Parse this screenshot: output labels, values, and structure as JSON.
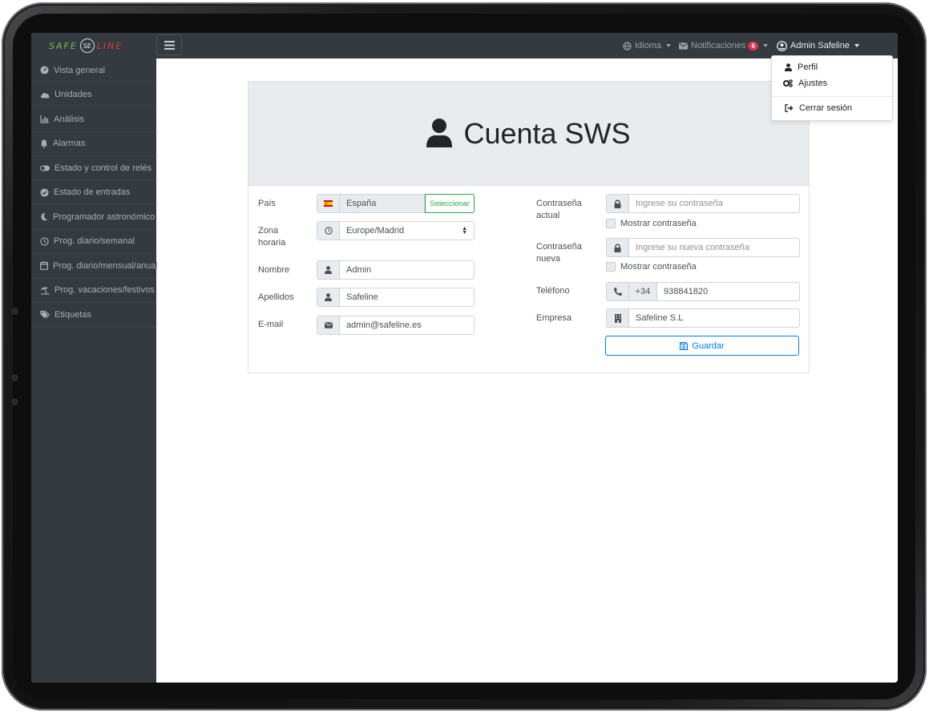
{
  "topbar": {
    "logo_left": "SAFE",
    "logo_mark": "SE",
    "logo_right": "LINE",
    "menu_icon": "hamburger-icon",
    "language": "Idioma",
    "notifications": "Notificaciones",
    "notifications_count": "6",
    "user": "Admin Safeline"
  },
  "sidebar": {
    "items": [
      {
        "label": "Vista general",
        "icon": "dashboard-icon"
      },
      {
        "label": "Unidades",
        "icon": "cloud-icon"
      },
      {
        "label": "Análisis",
        "icon": "chart-icon"
      },
      {
        "label": "Alarmas",
        "icon": "bell-icon"
      },
      {
        "label": "Estado y control de relés",
        "icon": "toggle-icon"
      },
      {
        "label": "Estado de entradas",
        "icon": "check-circle-icon"
      },
      {
        "label": "Programador astronómico",
        "icon": "moon-icon"
      },
      {
        "label": "Prog. diario/semanal",
        "icon": "clock-icon"
      },
      {
        "label": "Prog. diario/mensual/anual",
        "icon": "calendar-icon"
      },
      {
        "label": "Prog. vacaciones/festivos",
        "icon": "umbrella-beach-icon"
      },
      {
        "label": "Etiquetas",
        "icon": "tags-icon"
      }
    ]
  },
  "user_menu": {
    "profile": "Perfil",
    "settings": "Ajustes",
    "logout": "Cerrar sesión"
  },
  "form": {
    "title": "Cuenta SWS",
    "country": {
      "label": "País",
      "value": "España",
      "button": "Seleccionar",
      "flag": "spain-flag-icon"
    },
    "timezone": {
      "label_line1": "Zona",
      "label_line2": "horaria",
      "value": "Europe/Madrid"
    },
    "first_name": {
      "label": "Nombre",
      "value": "Admin"
    },
    "last_name": {
      "label": "Apellidos",
      "value": "Safeline"
    },
    "email": {
      "label": "E-mail",
      "value": "admin@safeline.es"
    },
    "current_password": {
      "label_line1": "Contraseña",
      "label_line2": "actual",
      "placeholder": "Ingrese su contraseña",
      "show": "Mostrar contraseña"
    },
    "new_password": {
      "label_line1": "Contraseña",
      "label_line2": "nueva",
      "placeholder": "Ingrese su nueva contraseña",
      "show": "Mostrar contraseña"
    },
    "phone": {
      "label": "Teléfono",
      "prefix": "+34",
      "value": "938841820"
    },
    "company": {
      "label": "Empresa",
      "value": "Safeline S.L"
    },
    "save": "Guardar"
  },
  "colors": {
    "sidebar": "#343a40",
    "accent": "#007bff",
    "select_green": "#28a745",
    "badge": "#dc3545",
    "header_bg": "#e9ecef"
  }
}
